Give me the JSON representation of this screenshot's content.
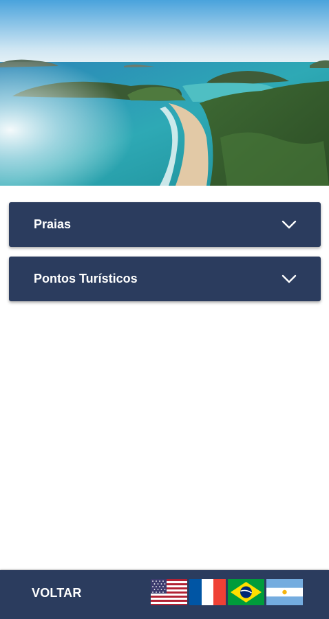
{
  "hero": {
    "image": "coastal-beach-aerial"
  },
  "sections": [
    {
      "label": "Praias",
      "icon": "chevron-down-icon"
    },
    {
      "label": "Pontos Turísticos",
      "icon": "chevron-down-icon"
    }
  ],
  "footer": {
    "back_label": "VOLTAR",
    "flags": [
      {
        "icon": "usa-flag-icon"
      },
      {
        "icon": "france-flag-icon"
      },
      {
        "icon": "brazil-flag-icon"
      },
      {
        "icon": "argentina-flag-icon"
      }
    ]
  },
  "colors": {
    "primary": "#2b3c5e",
    "text": "#ffffff",
    "background": "#ffffff"
  }
}
